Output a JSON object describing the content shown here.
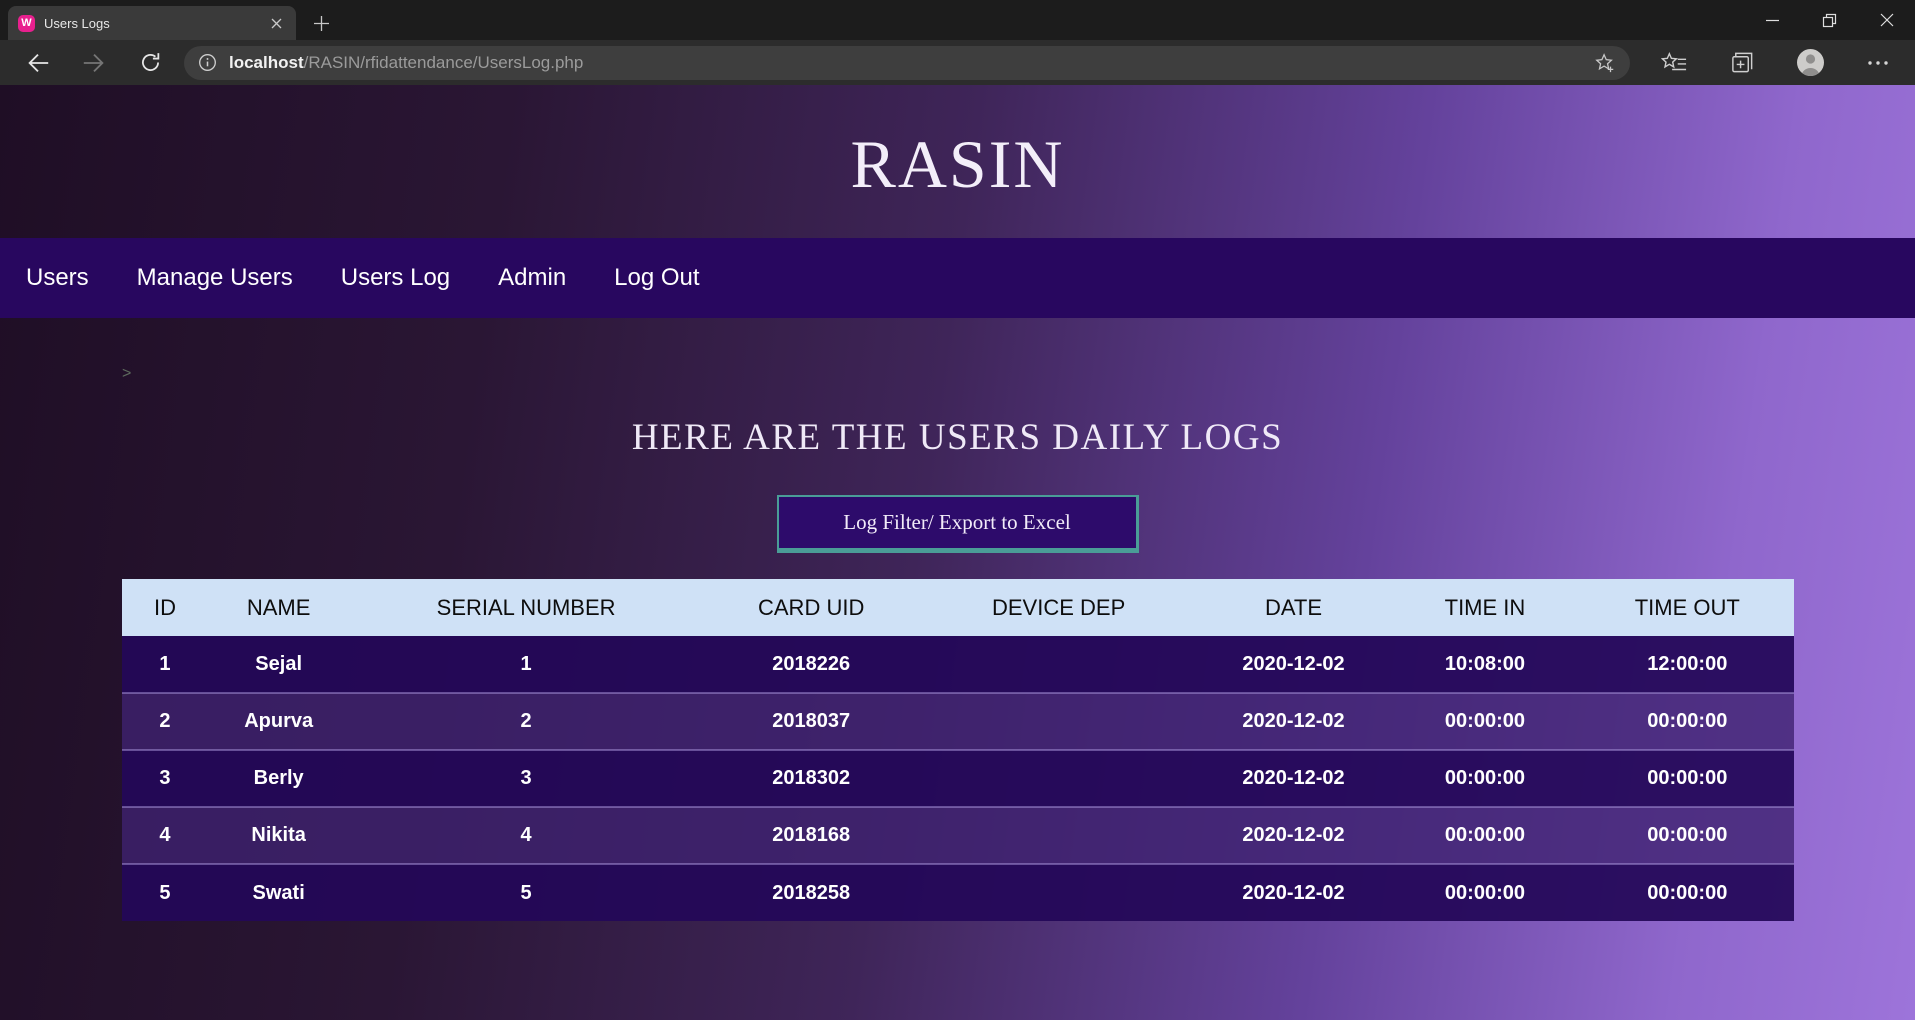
{
  "browser": {
    "tab_title": "Users Logs",
    "url_host": "localhost",
    "url_path": "/RASIN/rfidattendance/UsersLog.php"
  },
  "page": {
    "brand": "RASIN",
    "nav": [
      "Users",
      "Manage Users",
      "Users Log",
      "Admin",
      "Log Out"
    ],
    "stray": ">",
    "heading": "HERE ARE THE USERS DAILY LOGS",
    "button_label": "Log Filter/ Export to Excel",
    "table": {
      "columns": [
        "ID",
        "NAME",
        "SERIAL NUMBER",
        "CARD UID",
        "DEVICE DEP",
        "DATE",
        "TIME IN",
        "TIME OUT"
      ],
      "rows": [
        [
          "1",
          "Sejal",
          "1",
          "2018226",
          "",
          "2020-12-02",
          "10:08:00",
          "12:00:00"
        ],
        [
          "2",
          "Apurva",
          "2",
          "2018037",
          "",
          "2020-12-02",
          "00:00:00",
          "00:00:00"
        ],
        [
          "3",
          "Berly",
          "3",
          "2018302",
          "",
          "2020-12-02",
          "00:00:00",
          "00:00:00"
        ],
        [
          "4",
          "Nikita",
          "4",
          "2018168",
          "",
          "2020-12-02",
          "00:00:00",
          "00:00:00"
        ],
        [
          "5",
          "Swati",
          "5",
          "2018258",
          "",
          "2020-12-02",
          "00:00:00",
          "00:00:00"
        ]
      ]
    },
    "colors": {
      "navbar_bg": "#28075f",
      "button_bg": "#2d0b6b",
      "button_border_teal": "#4a9d97",
      "table_header_bg": "#cfe1f6",
      "row_odd": "#24085a",
      "row_even": "#3e2270",
      "favicon_pink": "#e8208e",
      "page_gradient_start": "#1f0e25",
      "page_gradient_end": "#9d74da"
    }
  }
}
